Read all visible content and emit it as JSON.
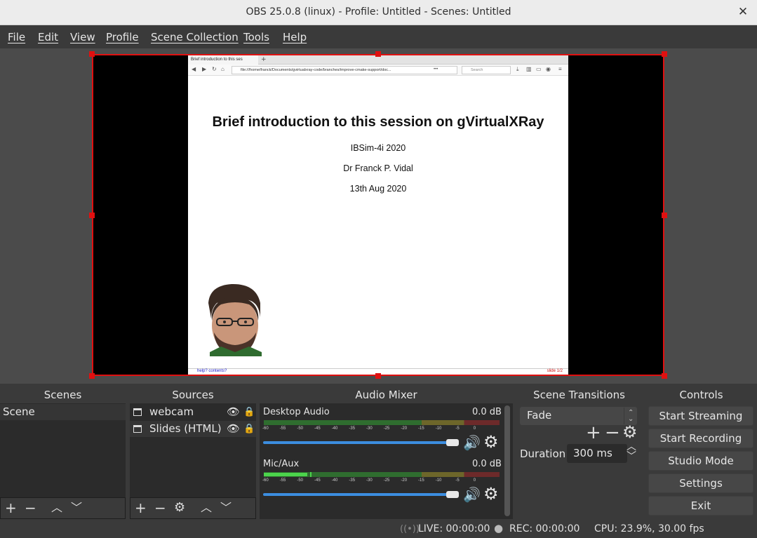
{
  "window": {
    "title": "OBS 25.0.8 (linux) - Profile: Untitled - Scenes: Untitled",
    "close_glyph": "✕"
  },
  "menu": [
    "File",
    "Edit",
    "View",
    "Profile",
    "Scene Collection",
    "Tools",
    "Help"
  ],
  "preview": {
    "browser": {
      "tab_title": "Brief introduction to this ses",
      "new_tab": "+",
      "url": "file:///home/franck/Documents/gvirtualxray-code/branches/improve-cmake-support/doc...",
      "url_more": "•••",
      "search_placeholder": "Search",
      "footer_left": "help? contents?",
      "footer_right": "slide 1/2"
    },
    "slide": {
      "title": "Brief introduction to this session on gVirtualXRay",
      "line1": "IBSim-4i 2020",
      "line2": "Dr Franck P. Vidal",
      "line3": "13th Aug 2020"
    }
  },
  "docks": {
    "scenes": {
      "title": "Scenes",
      "items": [
        "Scene"
      ]
    },
    "sources": {
      "title": "Sources",
      "items": [
        "webcam",
        "Slides (HTML)"
      ]
    },
    "mixer": {
      "title": "Audio Mixer",
      "channels": [
        {
          "name": "Desktop Audio",
          "level": "0.0 dB",
          "volume": 1.0
        },
        {
          "name": "Mic/Aux",
          "level": "0.0 dB",
          "volume": 1.0
        }
      ],
      "ticks": [
        "-60",
        "-55",
        "-50",
        "-45",
        "-40",
        "-35",
        "-30",
        "-25",
        "-20",
        "-15",
        "-10",
        "-5",
        "0"
      ]
    },
    "transitions": {
      "title": "Scene Transitions",
      "selected": "Fade",
      "duration_label": "Duration",
      "duration_value": "300 ms"
    },
    "controls": {
      "title": "Controls",
      "buttons": [
        "Start Streaming",
        "Start Recording",
        "Studio Mode",
        "Settings",
        "Exit"
      ]
    }
  },
  "status": {
    "live": "LIVE: 00:00:00",
    "rec": "REC: 00:00:00",
    "cpu": "CPU: 23.9%, 30.00 fps"
  },
  "colors": {
    "accent": "#3c8ee0",
    "selection": "#e01010",
    "meter_green": "#4cd44c",
    "meter_yellow": "#c8c040",
    "meter_red": "#c84040"
  }
}
